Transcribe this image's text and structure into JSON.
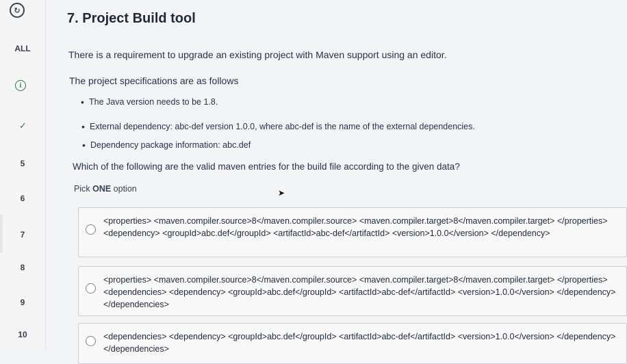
{
  "sidebar": {
    "all_label": "ALL",
    "numbers": [
      "5",
      "6",
      "7",
      "8",
      "9",
      "10"
    ]
  },
  "question": {
    "title": "7. Project Build tool",
    "intro": "There is a requirement to upgrade an existing project with Maven support using an editor.",
    "specs_heading": "The project specifications are as follows",
    "bullets": [
      "The Java version needs to be 1.8.",
      "External dependency: abc-def version 1.0.0, where abc-def is the name of the external dependencies.",
      "Dependency package information: abc.def"
    ],
    "prompt": "Which of the following are the valid maven entries for the build file according to the given data?",
    "pick_prefix": "Pick ",
    "pick_emphasis": "ONE",
    "pick_suffix": " option"
  },
  "options": [
    "<properties> <maven.compiler.source>8</maven.compiler.source> <maven.compiler.target>8</maven.compiler.target> </properties> <dependency> <groupId>abc.def</groupId> <artifactId>abc-def</artifactId> <version>1.0.0</version> </dependency>",
    "<properties> <maven.compiler.source>8</maven.compiler.source> <maven.compiler.target>8</maven.compiler.target> </properties> <dependencies> <dependency> <groupId>abc.def</groupId> <artifactId>abc-def</artifactId> <version>1.0.0</version> </dependency> </dependencies>",
    "<dependencies> <dependency> <groupId>abc.def</groupId> <artifactId>abc-def</artifactId> <version>1.0.0</version> </dependency> </dependencies>"
  ],
  "colors": {
    "accent": "#2f7d3f",
    "text": "#27324a"
  },
  "icons": [
    "logo-icon",
    "info-icon",
    "check-icon",
    "cursor-icon"
  ]
}
